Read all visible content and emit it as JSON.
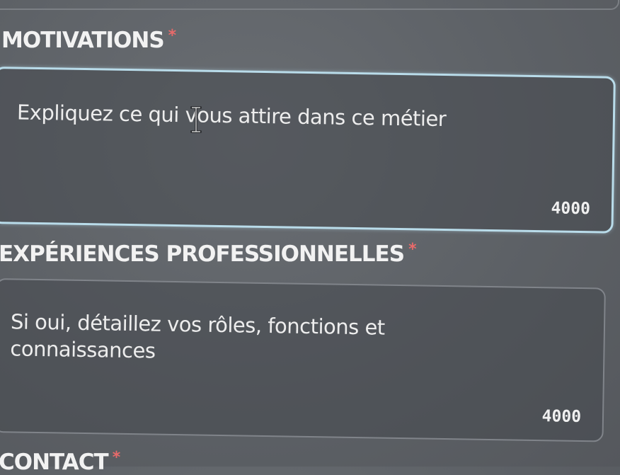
{
  "form": {
    "motivations": {
      "label": "MOTIVATIONS",
      "required_mark": "*",
      "placeholder": "Expliquez ce qui vous attire dans ce métier",
      "counter": "4000"
    },
    "experiences": {
      "label": "EXPÉRIENCES PROFESSIONNELLES",
      "required_mark": "*",
      "placeholder_line1": "Si oui, détaillez vos rôles, fonctions et",
      "placeholder_line2": "connaissances",
      "counter": "4000"
    },
    "contact": {
      "label": "CONTACT",
      "required_mark": "*"
    }
  },
  "icons": {
    "text_cursor": "i-beam-cursor-icon"
  },
  "colors": {
    "focus_border": "#b9dcea",
    "required_mark": "#e86a6a",
    "background": "#5f6368"
  }
}
